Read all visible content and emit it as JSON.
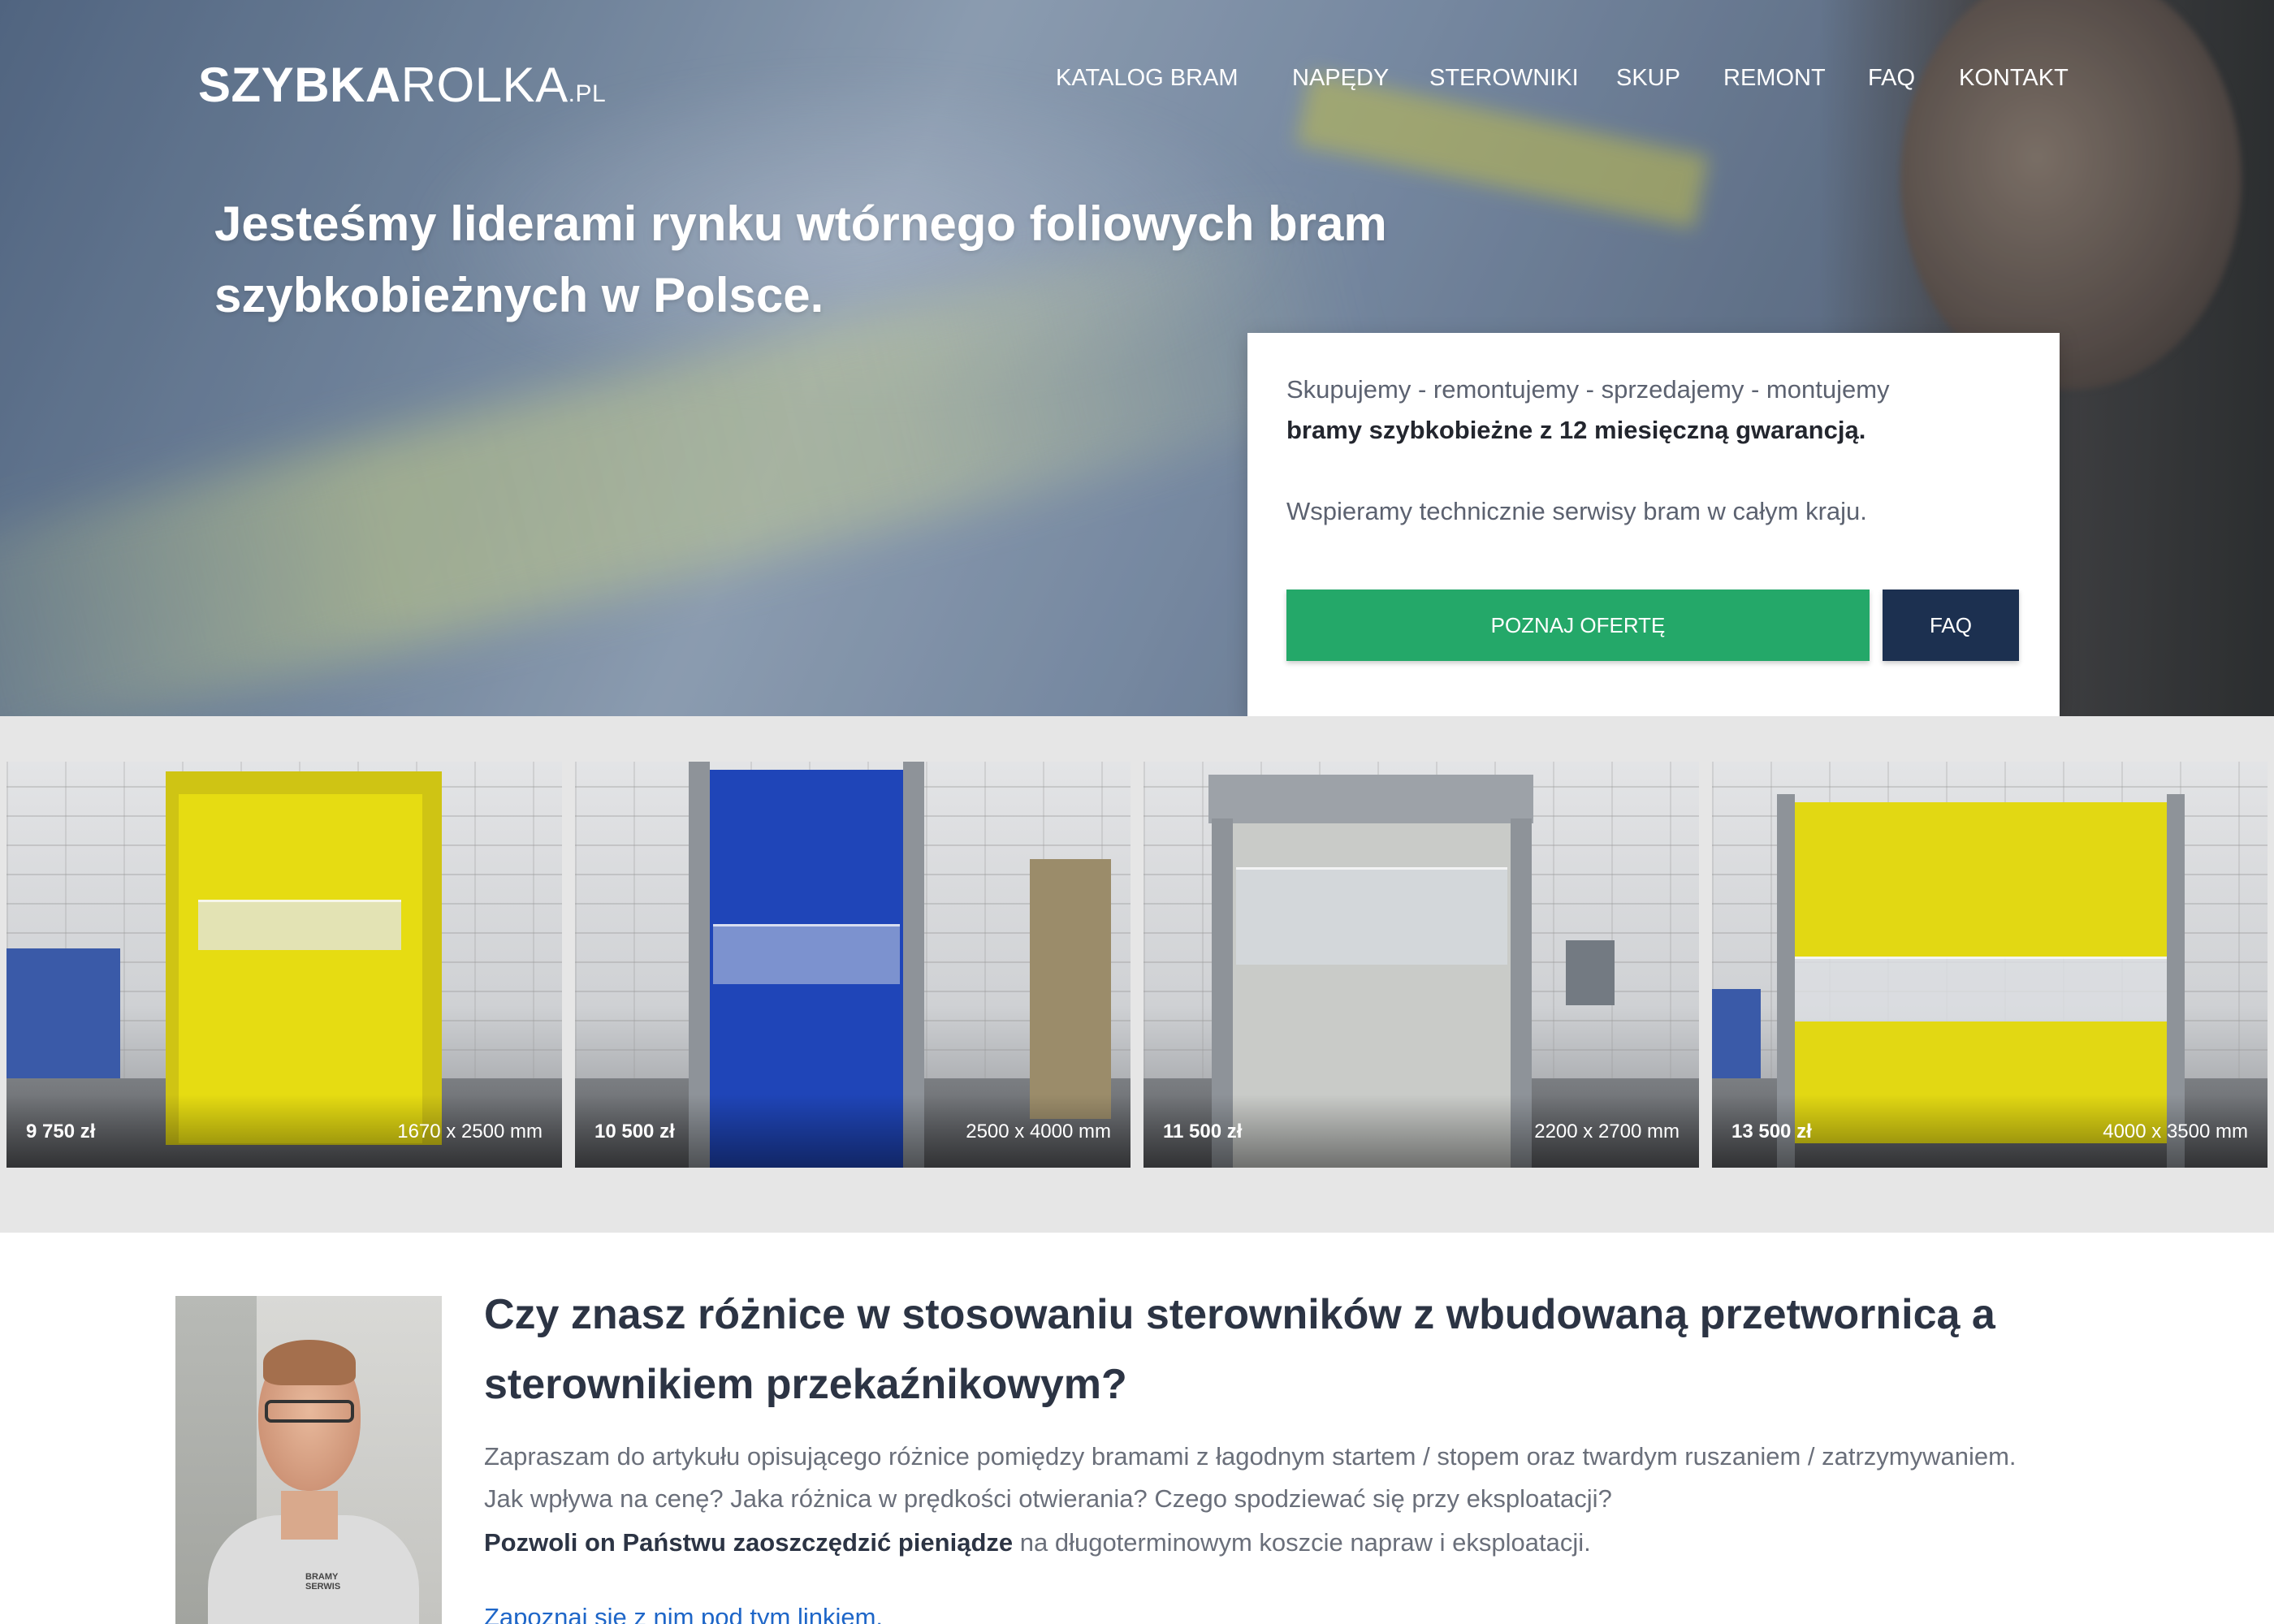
{
  "header": {
    "logo": {
      "bold": "SZYBKA",
      "regular": "ROLKA",
      "tld": ".PL"
    },
    "nav": [
      {
        "label": "KATALOG BRAM"
      },
      {
        "label": "NAPĘDY"
      },
      {
        "label": "STEROWNIKI"
      },
      {
        "label": "SKUP"
      },
      {
        "label": "REMONT"
      },
      {
        "label": "FAQ"
      },
      {
        "label": "KONTAKT"
      }
    ]
  },
  "hero": {
    "title_line1": "Jesteśmy liderami rynku wtórnego foliowych bram",
    "title_line2": "szybkobieżnych w Polsce.",
    "card": {
      "line1": "Skupujemy - remontujemy - sprzedajemy - montujemy",
      "line2": "bramy szybkobieżne z 12 miesięczną gwarancją.",
      "line3": "Wspieramy technicznie serwisy bram w całym kraju.",
      "primary_button": "POZNAJ OFERTĘ",
      "secondary_button": "FAQ"
    }
  },
  "gallery": {
    "items": [
      {
        "price": "9 750 zł",
        "dimensions": "1670 x 2500 mm",
        "door_color": "#e6dc12"
      },
      {
        "price": "10 500 zł",
        "dimensions": "2500 x 4000 mm",
        "door_color": "#1f45b8"
      },
      {
        "price": "11 500 zł",
        "dimensions": "2200 x 2700 mm",
        "door_color": "#c9cbc8"
      },
      {
        "price": "13 500 zł",
        "dimensions": "4000 x 3500 mm",
        "door_color": "#e2d813"
      }
    ]
  },
  "article": {
    "title_line1": "Czy znasz różnice w stosowaniu sterowników z wbudowaną przetwornicą a",
    "title_line2": "sterownikiem przekaźnikowym?",
    "paragraph1_line1": "Zapraszam do artykułu opisującego różnice pomiędzy bramami z łagodnym startem / stopem oraz twardym ruszaniem / zatrzymywaniem.",
    "paragraph1_line2": "Jak wpływa na cenę? Jaka różnica w prędkości otwierania? Czego spodziewać się przy eksploatacji?",
    "paragraph2_bold": "Pozwoli on Państwu zaoszczędzić pieniądze",
    "paragraph2_rest": " na długoterminowym koszcie napraw i eksploatacji.",
    "link_text": "Zapoznaj się z nim pod tym linkiem.",
    "portrait_shirt_text": "BRAMY SERWIS"
  },
  "colors": {
    "primary_green": "#24a869",
    "navy": "#1c3050",
    "link_blue": "#1e66c8"
  }
}
